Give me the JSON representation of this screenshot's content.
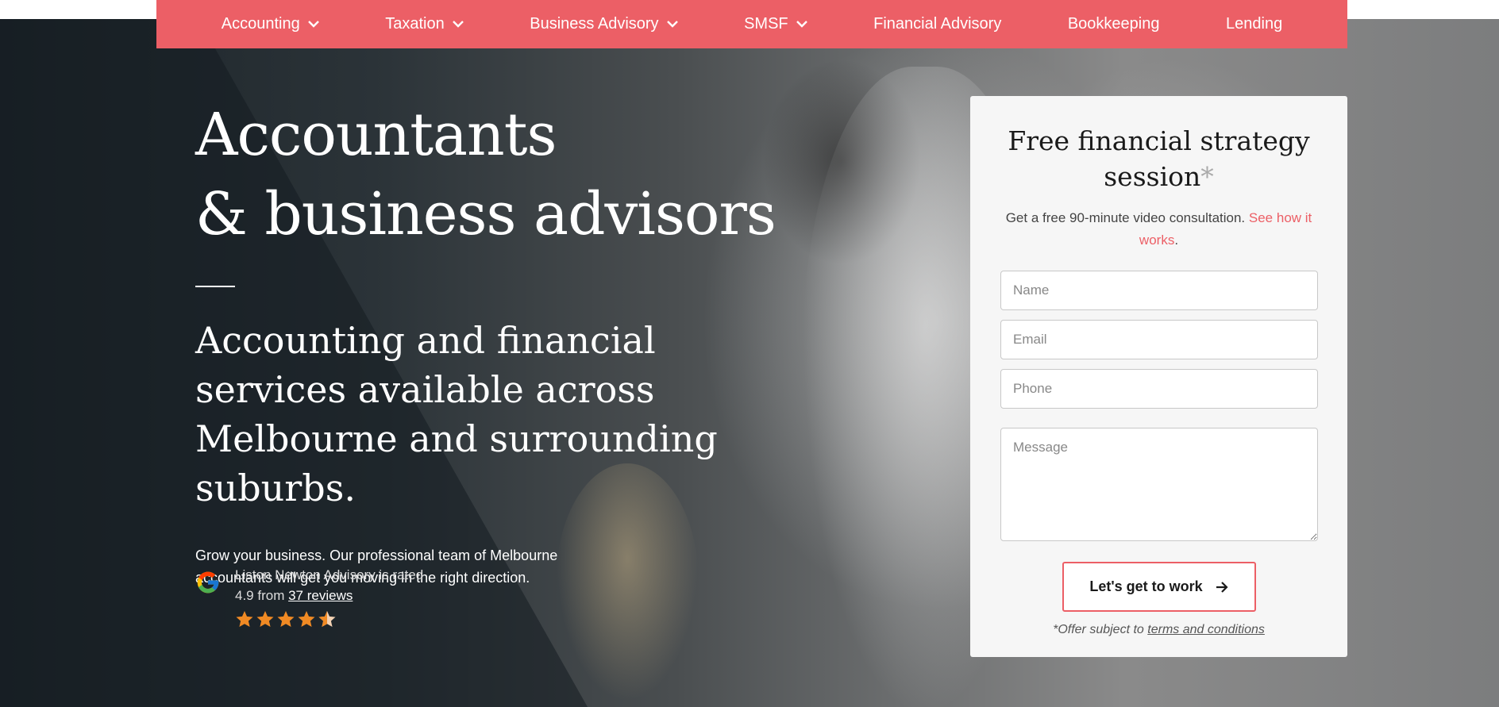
{
  "nav": {
    "items": [
      {
        "label": "Accounting",
        "dropdown": true
      },
      {
        "label": "Taxation",
        "dropdown": true
      },
      {
        "label": "Business Advisory",
        "dropdown": true
      },
      {
        "label": "SMSF",
        "dropdown": true
      },
      {
        "label": "Financial Advisory",
        "dropdown": false
      },
      {
        "label": "Bookkeeping",
        "dropdown": false
      },
      {
        "label": "Lending",
        "dropdown": false
      }
    ]
  },
  "hero": {
    "title_line1": "Accountants",
    "title_line2": "& business advisors",
    "subtitle": "Accounting and financial services available across Melbourne and surrounding suburbs.",
    "lead": "Grow your business. Our professional team of Melbourne accountants will get you moving in the right direction."
  },
  "rating": {
    "line1": "Liston Newton Advisory is rated",
    "score_text": "4.9 from",
    "reviews_link": "37 reviews",
    "score": 4.9,
    "icon": "google-g-icon"
  },
  "form": {
    "title": "Free financial strategy session",
    "asterisk": "*",
    "subtitle": "Get a free 90-minute video consultation.",
    "see_how": "See how it works",
    "period": ".",
    "name_placeholder": "Name",
    "email_placeholder": "Email",
    "phone_placeholder": "Phone",
    "message_placeholder": "Message",
    "submit_label": "Let's get to work",
    "offer_text": "*Offer subject to",
    "terms_link": "terms and conditions"
  },
  "colors": {
    "accent": "#ec5f66",
    "star": "#f08a24",
    "card": "#f6f6f6"
  }
}
